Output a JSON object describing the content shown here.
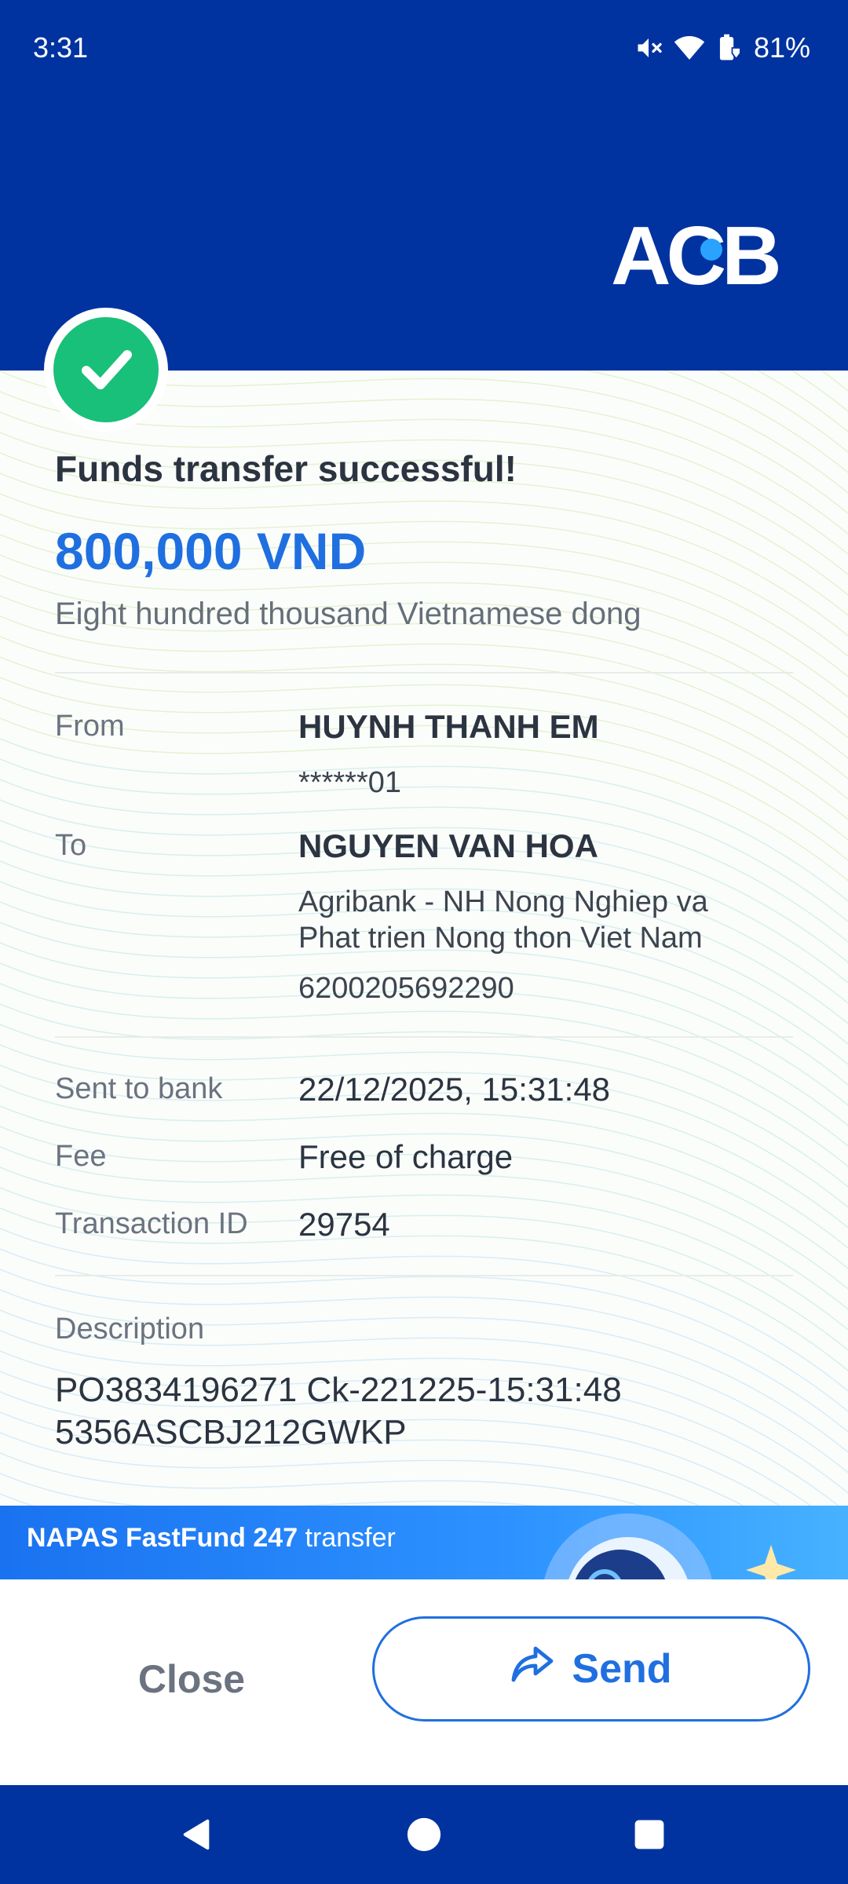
{
  "status_bar": {
    "time": "3:31",
    "battery": "81%",
    "icons": [
      "mute-icon",
      "wifi-icon",
      "battery-saver-icon"
    ]
  },
  "brand": {
    "logo_text": "ACB",
    "color": "#0133a0",
    "dot_color": "#29a3ff"
  },
  "receipt": {
    "title": "Funds transfer successful!",
    "amount": "800,000 VND",
    "amount_words": "Eight hundred thousand Vietnamese dong",
    "from_label": "From",
    "from_name": "HUYNH THANH EM",
    "from_account": "******01",
    "to_label": "To",
    "to_name": "NGUYEN VAN HOA",
    "to_bank_line1": "Agribank - NH Nong Nghiep va",
    "to_bank_line2": "Phat trien Nong thon Viet Nam",
    "to_account": "6200205692290",
    "sent_label": "Sent to bank",
    "sent_value": "22/12/2025, 15:31:48",
    "fee_label": "Fee",
    "fee_value": "Free of charge",
    "txn_label": "Transaction ID",
    "txn_value": "29754",
    "desc_label": "Description",
    "desc_line1": "PO3834196271 Ck-221225-15:31:48",
    "desc_line2": "5356ASCBJ212GWKP"
  },
  "banner": {
    "bold": "NAPAS FastFund 247",
    "rest": " transfer"
  },
  "actions": {
    "close_label": "Close",
    "send_label": "Send"
  },
  "colors": {
    "success": "#19c07a",
    "accent": "#1f6fe0",
    "nav": "#0133a0"
  }
}
